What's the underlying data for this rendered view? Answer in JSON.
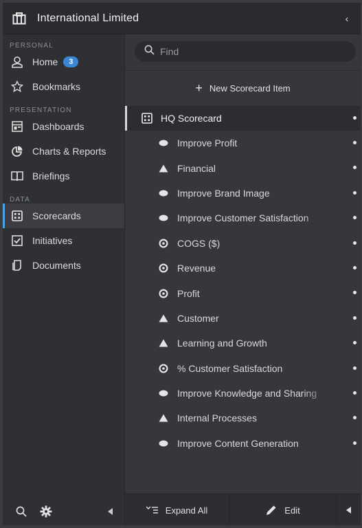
{
  "header": {
    "title": "International Limited",
    "collapse_glyph": "‹"
  },
  "sidebar": {
    "sections": [
      {
        "label": "PERSONAL",
        "items": [
          {
            "label": "Home",
            "icon": "user-icon",
            "badge": "3"
          },
          {
            "label": "Bookmarks",
            "icon": "star-icon"
          }
        ]
      },
      {
        "label": "PRESENTATION",
        "items": [
          {
            "label": "Dashboards",
            "icon": "dashboard-icon"
          },
          {
            "label": "Charts & Reports",
            "icon": "pie-chart-icon"
          },
          {
            "label": "Briefings",
            "icon": "book-icon"
          }
        ]
      },
      {
        "label": "DATA",
        "items": [
          {
            "label": "Scorecards",
            "icon": "scorecard-icon",
            "active": true
          },
          {
            "label": "Initiatives",
            "icon": "checkbox-icon"
          },
          {
            "label": "Documents",
            "icon": "document-icon"
          }
        ]
      }
    ]
  },
  "search": {
    "placeholder": "Find"
  },
  "new_item": {
    "label": "New Scorecard Item"
  },
  "scorecard": {
    "title": "HQ Scorecard",
    "items": [
      {
        "label": "Improve Profit",
        "type": "objective"
      },
      {
        "label": "Financial",
        "type": "perspective"
      },
      {
        "label": "Improve Brand Image",
        "type": "objective"
      },
      {
        "label": "Improve Customer Satisfaction",
        "type": "objective",
        "truncated": true
      },
      {
        "label": "COGS ($)",
        "type": "kpi"
      },
      {
        "label": "Revenue",
        "type": "kpi"
      },
      {
        "label": "Profit",
        "type": "kpi"
      },
      {
        "label": "Customer",
        "type": "perspective"
      },
      {
        "label": "Learning and Growth",
        "type": "perspective"
      },
      {
        "label": "% Customer Satisfaction",
        "type": "kpi"
      },
      {
        "label": "Improve Knowledge and Sharing",
        "type": "objective",
        "truncated": true
      },
      {
        "label": "Internal Processes",
        "type": "perspective"
      },
      {
        "label": "Improve Content Generation",
        "type": "objective"
      }
    ]
  },
  "footer": {
    "expand_label": "Expand All",
    "edit_label": "Edit"
  },
  "colors": {
    "accent": "#4aa3df",
    "badge": "#3b86d4"
  }
}
